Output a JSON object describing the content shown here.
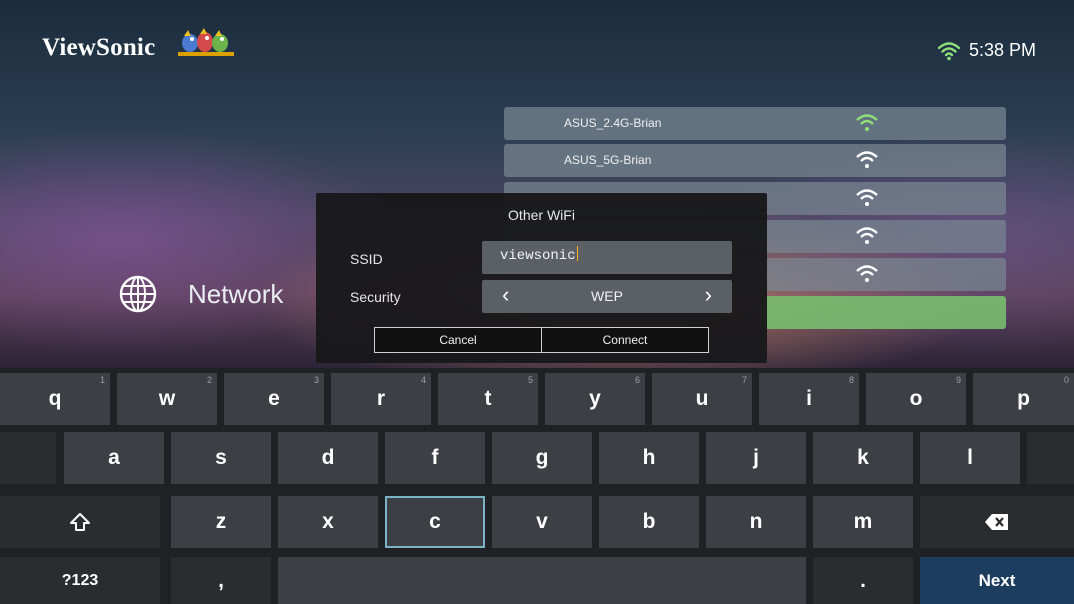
{
  "brand": {
    "name": "ViewSonic"
  },
  "status": {
    "time": "5:38 PM",
    "wifi_icon": "wifi-icon"
  },
  "wifi_list": [
    {
      "ssid": "ASUS_2.4G-Brian"
    },
    {
      "ssid": "ASUS_5G-Brian"
    },
    {
      "ssid": ""
    },
    {
      "ssid": ""
    },
    {
      "ssid": ""
    }
  ],
  "sidebar": {
    "network_label": "Network",
    "network_icon": "globe-icon"
  },
  "dialog": {
    "title": "Other WiFi",
    "ssid_label": "SSID",
    "ssid_value": "viewsonic",
    "security_label": "Security",
    "security_value": "WEP",
    "cancel_label": "Cancel",
    "connect_label": "Connect"
  },
  "keyboard": {
    "row1": [
      {
        "k": "q",
        "h": "1"
      },
      {
        "k": "w",
        "h": "2"
      },
      {
        "k": "e",
        "h": "3"
      },
      {
        "k": "r",
        "h": "4"
      },
      {
        "k": "t",
        "h": "5"
      },
      {
        "k": "y",
        "h": "6"
      },
      {
        "k": "u",
        "h": "7"
      },
      {
        "k": "i",
        "h": "8"
      },
      {
        "k": "o",
        "h": "9"
      },
      {
        "k": "p",
        "h": "0"
      }
    ],
    "row2": [
      "a",
      "s",
      "d",
      "f",
      "g",
      "h",
      "j",
      "k",
      "l"
    ],
    "row3": [
      "z",
      "x",
      "c",
      "v",
      "b",
      "n",
      "m"
    ],
    "selected_key": "c",
    "symbols_label": "?123",
    "comma_label": ",",
    "period_label": ".",
    "next_label": "Next"
  }
}
